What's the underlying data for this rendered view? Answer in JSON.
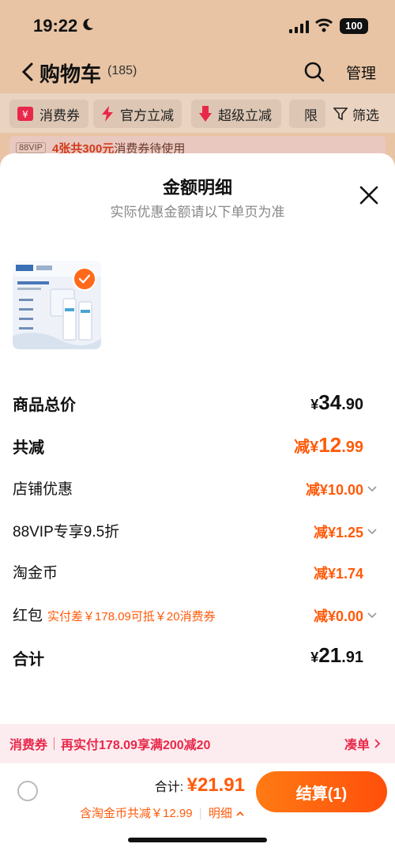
{
  "status": {
    "time": "19:22",
    "battery": "100"
  },
  "header": {
    "title": "购物车",
    "count": "(185)",
    "manage": "管理"
  },
  "filters": {
    "chips": [
      "消费券",
      "官方立减",
      "超级立减",
      "限"
    ],
    "filter_label": "筛选"
  },
  "vip_banner": {
    "tag": "88VIP",
    "highlight": "4张共300元",
    "text": "消费券待使用"
  },
  "sheet": {
    "title": "金额明细",
    "subtitle": "实际优惠金额请以下单页为准",
    "rows": [
      {
        "label": "商品总价",
        "symbol": "¥",
        "int": "34",
        "dec": ".90"
      },
      {
        "label": "共减",
        "prefix": "减¥",
        "int": "12",
        "dec": ".99"
      },
      {
        "label": "店铺优惠",
        "value": "减¥10.00"
      },
      {
        "label": "88VIP专享9.5折",
        "value": "减¥1.25"
      },
      {
        "label": "淘金币",
        "value": "减¥1.74"
      },
      {
        "label": "红包",
        "hint": "实付差￥178.09可抵￥20消费券",
        "value": "减¥0.00"
      },
      {
        "label": "合计",
        "symbol": "¥",
        "int": "21",
        "dec": ".91"
      }
    ]
  },
  "coupon_bar": {
    "tag": "消费券",
    "text": "再实付178.09享满200减20",
    "link": "凑单"
  },
  "bottom": {
    "total_label": "合计:",
    "total_amount": "¥21.91",
    "discount": "含淘金币共减￥12.99",
    "detail": "明细",
    "checkout": "结算(1)"
  },
  "colors": {
    "accent": "#ff5a0a",
    "coupon": "#e8284a",
    "check": "#ff6a1a"
  }
}
